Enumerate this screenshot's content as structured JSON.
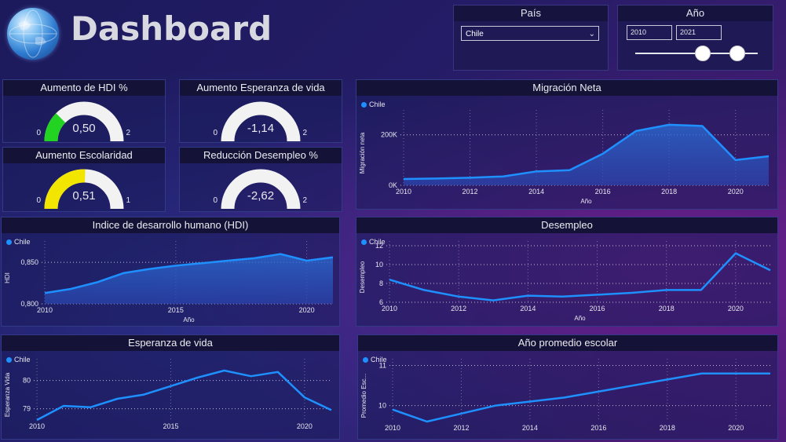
{
  "header": {
    "title": "Dashboard",
    "logo_icon": "globe-icon"
  },
  "slicers": {
    "pais": {
      "title": "País",
      "value": "Chile"
    },
    "anio": {
      "title": "Año",
      "from": "2010",
      "to": "2021",
      "range": [
        2010,
        2021
      ]
    }
  },
  "gauges": [
    {
      "title": "Aumento de HDI %",
      "value": "0,50",
      "min": "0",
      "max": "2",
      "fraction": 0.25,
      "color": "#22d322"
    },
    {
      "title": "Aumento Esperanza de vida",
      "value": "-1,14",
      "min": "0",
      "max": "2",
      "fraction": 0,
      "color": "#22d322"
    },
    {
      "title": "Aumento Escolaridad",
      "value": "0,51",
      "min": "0",
      "max": "1",
      "fraction": 0.51,
      "color": "#f2e600"
    },
    {
      "title": "Reducción Desempleo %",
      "value": "-2,62",
      "min": "0",
      "max": "2",
      "fraction": 0,
      "color": "#22d322"
    }
  ],
  "chart_data": [
    {
      "id": "migracion",
      "type": "area",
      "title": "Migración Neta",
      "legend": "Chile",
      "xlabel": "Año",
      "ylabel": "Migración neta",
      "x": [
        2010,
        2011,
        2012,
        2013,
        2014,
        2015,
        2016,
        2017,
        2018,
        2019,
        2020,
        2021
      ],
      "values": [
        25000,
        27000,
        30000,
        35000,
        55000,
        60000,
        125000,
        215000,
        240000,
        235000,
        100000,
        115000
      ],
      "ylim": [
        0,
        280000
      ],
      "yticks": [
        0,
        200000
      ],
      "ytick_labels": [
        "0K",
        "200K"
      ],
      "xticks": [
        2010,
        2012,
        2014,
        2016,
        2018,
        2020
      ]
    },
    {
      "id": "hdi",
      "type": "area",
      "title": "Indice de desarrollo humano (HDI)",
      "legend": "Chile",
      "xlabel": "Año",
      "ylabel": "HDI",
      "x": [
        2010,
        2011,
        2012,
        2013,
        2014,
        2015,
        2016,
        2017,
        2018,
        2019,
        2020,
        2021
      ],
      "values": [
        0.813,
        0.818,
        0.826,
        0.837,
        0.842,
        0.846,
        0.849,
        0.852,
        0.855,
        0.86,
        0.852,
        0.856
      ],
      "ylim": [
        0.8,
        0.87
      ],
      "yticks": [
        0.8,
        0.85
      ],
      "ytick_labels": [
        "0,800",
        "0,850"
      ],
      "xticks": [
        2010,
        2015,
        2020
      ]
    },
    {
      "id": "desempleo",
      "type": "line",
      "title": "Desempleo",
      "legend": "Chile",
      "xlabel": "Año",
      "ylabel": "Desempleo",
      "x": [
        2010,
        2011,
        2012,
        2013,
        2014,
        2015,
        2016,
        2017,
        2018,
        2019,
        2020,
        2021
      ],
      "values": [
        8.4,
        7.3,
        6.6,
        6.2,
        6.7,
        6.6,
        6.8,
        7.0,
        7.3,
        7.3,
        11.2,
        9.4
      ],
      "ylim": [
        6,
        12
      ],
      "yticks": [
        6,
        8,
        10,
        12
      ],
      "ytick_labels": [
        "6",
        "8",
        "10",
        "12"
      ],
      "xticks": [
        2010,
        2012,
        2014,
        2016,
        2018,
        2020
      ]
    },
    {
      "id": "esperanza",
      "type": "line",
      "title": "Esperanza de vida",
      "legend": "Chile",
      "xlabel": "",
      "ylabel": "Esperanza Vida",
      "x": [
        2010,
        2011,
        2012,
        2013,
        2014,
        2015,
        2016,
        2017,
        2018,
        2019,
        2020,
        2021
      ],
      "values": [
        78.6,
        79.1,
        79.05,
        79.35,
        79.5,
        79.8,
        80.1,
        80.35,
        80.15,
        80.3,
        79.4,
        78.95
      ],
      "ylim": [
        78.6,
        80.6
      ],
      "yticks": [
        79,
        80
      ],
      "ytick_labels": [
        "79",
        "80"
      ],
      "xticks": [
        2010,
        2015,
        2020
      ]
    },
    {
      "id": "escolar",
      "type": "line",
      "title": "Año promedio escolar",
      "legend": "Chile",
      "xlabel": "",
      "ylabel": "Promedio Esc...",
      "x": [
        2010,
        2011,
        2012,
        2013,
        2014,
        2015,
        2016,
        2017,
        2018,
        2019,
        2020,
        2021
      ],
      "values": [
        9.9,
        9.6,
        9.8,
        10.0,
        10.1,
        10.2,
        10.35,
        10.5,
        10.65,
        10.8,
        10.8,
        10.8
      ],
      "ylim": [
        9.6,
        11.05
      ],
      "yticks": [
        10,
        11
      ],
      "ytick_labels": [
        "10",
        "11"
      ],
      "xticks": [
        2010,
        2012,
        2014,
        2016,
        2018,
        2020
      ]
    }
  ],
  "colors": {
    "series": "#1e90ff",
    "area_top": "#2a6fd8",
    "area_bottom": "#2a46b0"
  }
}
